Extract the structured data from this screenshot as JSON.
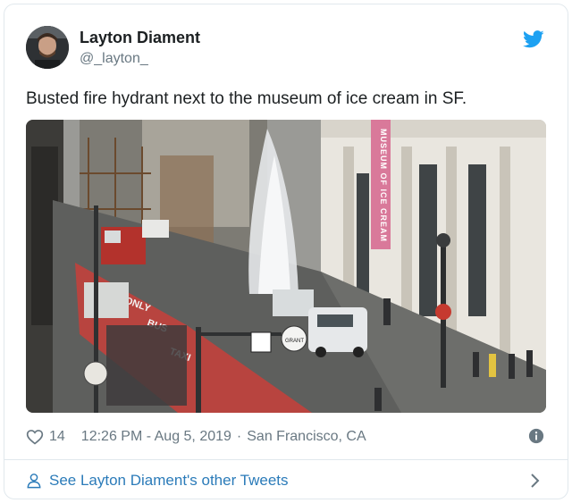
{
  "tweet": {
    "author_name": "Layton Diament",
    "author_handle": "@_layton_",
    "text": "Busted fire hydrant next to the museum of ice cream in SF.",
    "likes": "14",
    "timestamp": "12:26 PM - Aug 5, 2019",
    "separator": "·",
    "location": "San Francisco, CA",
    "footer_link": "See Layton Diament's other Tweets"
  },
  "photo": {
    "banner_text": "MUSEUM OF ICE CREAM",
    "sign_grant": "GRANT",
    "road_text_1": "ONLY",
    "road_text_2": "BUS",
    "road_text_3": "TAXI"
  },
  "colors": {
    "link_blue": "#2b7bb9",
    "twitter_blue": "#1da1f2",
    "muted_gray": "#697882",
    "banner_pink": "#d9799a",
    "bus_lane_red": "#b8443f"
  },
  "icons": {
    "logo": "twitter-bird-icon",
    "likes": "heart-icon",
    "info": "info-icon",
    "profile": "person-icon",
    "more": "chevron-right-icon"
  }
}
